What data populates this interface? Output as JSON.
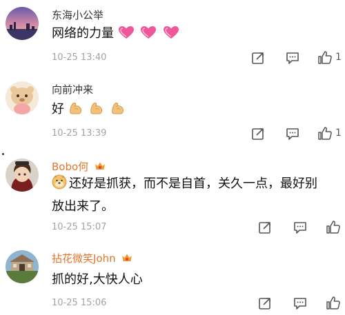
{
  "comments": [
    {
      "username": "东海小公举",
      "text": "网络的力量",
      "emoji_after": [
        "heart-emoji",
        "heart-emoji",
        "heart-emoji"
      ],
      "timestamp": "10-25 13:40",
      "like_count": "1"
    },
    {
      "username": "向前冲来",
      "text": "好",
      "emoji_after": [
        "muscle-emoji",
        "muscle-emoji",
        "muscle-emoji"
      ],
      "timestamp": "10-25 13:39",
      "like_count": "1"
    },
    {
      "username": "Bobo何",
      "text_line1": "还好是抓获，而不是自首，关久一点，最好别",
      "text_line2": "放出来了。",
      "emoji_before": "doge-emoji",
      "timestamp": "10-25 15:07",
      "like_count": ""
    },
    {
      "username": "拈花微笑John",
      "text": "抓的好,大快人心",
      "timestamp": "10-25 15:06",
      "like_count": ""
    }
  ],
  "colors": {
    "vip_name": "#e3742a",
    "plain_name": "#333333",
    "timestamp": "#a3a3a3",
    "icon": "#555555"
  }
}
